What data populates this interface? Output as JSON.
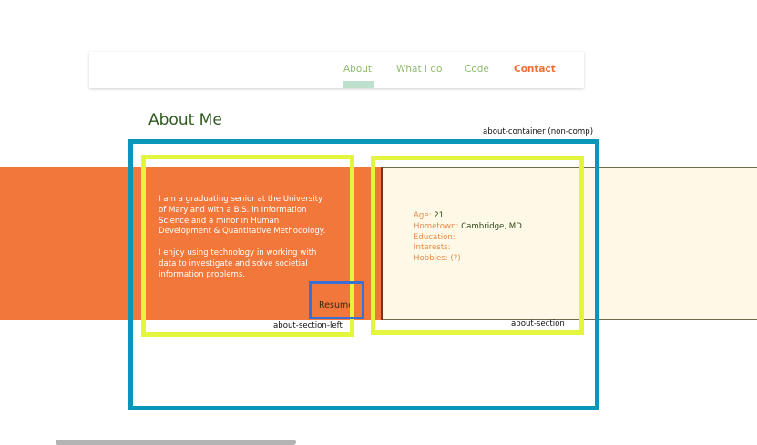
{
  "nav": {
    "items": [
      {
        "label": "About"
      },
      {
        "label": "What I do"
      },
      {
        "label": "Code"
      },
      {
        "label": "Contact"
      }
    ]
  },
  "page": {
    "title": "About Me"
  },
  "about_left": {
    "paragraphs": [
      "I am a graduating senior at the University of Maryland with a B.S. in Information Science and a minor in Human Development & Quantitative Methodology.",
      "I enjoy using technology in working with data to investigate and solve societial information problems."
    ],
    "resume_label": "Resume"
  },
  "about_right": {
    "facts": [
      {
        "label": "Age:",
        "value": "21"
      },
      {
        "label": "Hometown:",
        "value": "Cambridge, MD"
      },
      {
        "label": "Education:",
        "value": ""
      },
      {
        "label": "Interests:",
        "value": ""
      },
      {
        "label": "Hobbies: (?)",
        "value": ""
      }
    ]
  },
  "overlay_labels": {
    "container": "about-container (non-comp)",
    "left": "about-section-left",
    "right": "about-section"
  },
  "colors": {
    "orange": "#f2773a",
    "cream": "#fef9e6",
    "blue_box": "#0a96b8",
    "yellow_box": "#e4f53d",
    "resume_box": "#3a6fd6",
    "nav_green": "#8fbb6c",
    "contact": "#f26d33"
  }
}
